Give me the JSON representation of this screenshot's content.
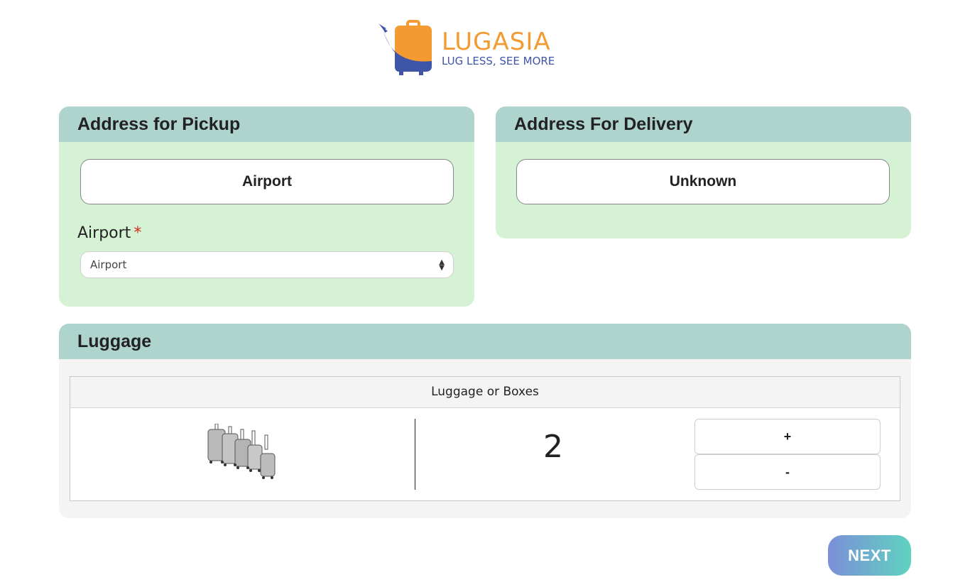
{
  "logo": {
    "name": "LUGASIA",
    "tagline": "LUG LESS, SEE MORE"
  },
  "pickup": {
    "title": "Address for Pickup",
    "type_button": "Airport",
    "field_label": "Airport",
    "required_mark": "*",
    "select_value": "Airport"
  },
  "delivery": {
    "title": "Address For Delivery",
    "type_button": "Unknown"
  },
  "luggage": {
    "title": "Luggage",
    "table_header": "Luggage or Boxes",
    "item_icon": "luggage-set-icon",
    "count": "2",
    "plus_label": "+",
    "minus_label": "-"
  },
  "next_label": "NEXT",
  "colors": {
    "header_bg": "#AED4CD",
    "green_body": "#D5F2D4",
    "grey_body": "#F4F4F4",
    "logo_orange": "#F39A32",
    "logo_blue": "#3E55A8",
    "next_gradient_start": "#7B8FD8",
    "next_gradient_end": "#5FD3C0"
  }
}
